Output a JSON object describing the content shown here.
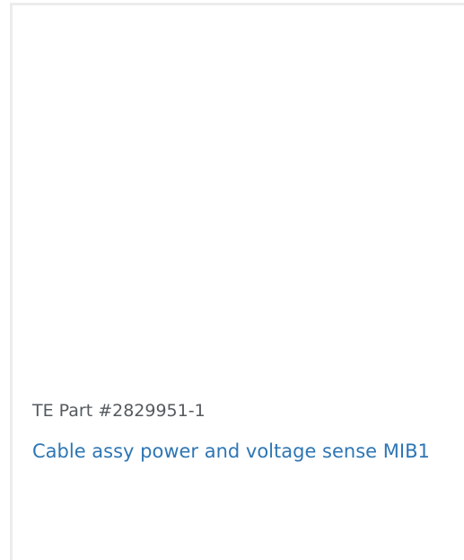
{
  "product": {
    "part_number": "TE Part #2829951-1",
    "title": "Cable assy power and voltage sense MIB1"
  },
  "colors": {
    "border": "#ececec",
    "part_number_text": "#555a5f",
    "title_link": "#2e76b4"
  }
}
